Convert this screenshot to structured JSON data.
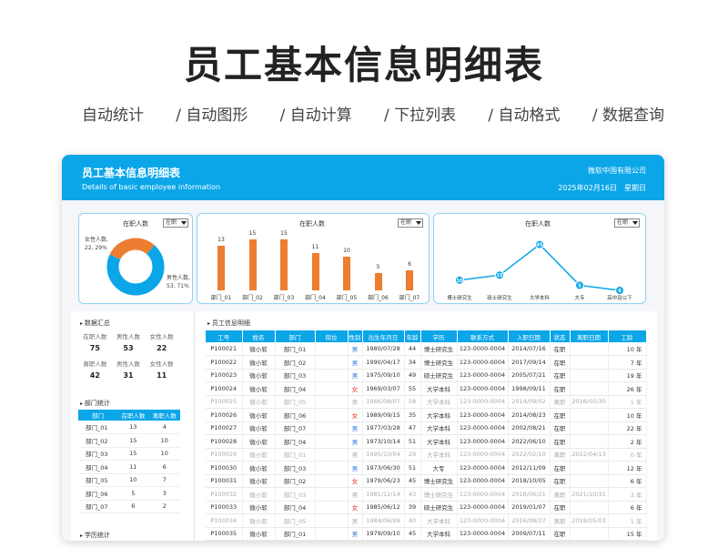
{
  "hero": {
    "title": "员工基本信息明细表",
    "features": [
      "自动统计",
      "/  自动图形",
      "/  自动计算",
      "/  下拉列表",
      "/  自动格式",
      "/  数据查询"
    ]
  },
  "header": {
    "title": "员工基本信息明细表",
    "subtitle": "Details of basic employee information",
    "company": "微软中国有限公司",
    "date": "2025年02月16日",
    "weekday": "星期日"
  },
  "colors": {
    "accent": "#0aa6e8",
    "bar": "#ed7d31",
    "card_border": "#8fd3f0"
  },
  "filter": {
    "selected": "在职"
  },
  "donut": {
    "title": "在职人数",
    "female_label": "女性人数,",
    "female_value": "22, 29%",
    "male_label": "男性人数,",
    "male_value": "53, 71%"
  },
  "bar_card": {
    "title": "在职人数"
  },
  "line_card": {
    "title": "在职人数"
  },
  "chart_data": [
    {
      "type": "pie",
      "title": "在职人数",
      "categories": [
        "女性人数",
        "男性人数"
      ],
      "values": [
        22,
        53
      ],
      "percent": [
        29,
        71
      ],
      "colors": [
        "#ed7d31",
        "#0aa6e8"
      ]
    },
    {
      "type": "bar",
      "title": "在职人数",
      "categories": [
        "部门_01",
        "部门_02",
        "部门_03",
        "部门_04",
        "部门_05",
        "部门_06",
        "部门_07"
      ],
      "values": [
        13,
        15,
        15,
        11,
        10,
        5,
        6
      ],
      "ylim": [
        0,
        16
      ]
    },
    {
      "type": "line",
      "title": "在职人数",
      "categories": [
        "博士研究生",
        "硕士研究生",
        "大学本科",
        "大专",
        "高中及以下"
      ],
      "values": [
        10,
        15,
        45,
        5,
        0
      ],
      "ylim": [
        0,
        50
      ]
    }
  ],
  "summary": {
    "title": "数据汇总",
    "labels_row1": [
      "在职人数",
      "男性人数",
      "女性人数"
    ],
    "values_row1": [
      "75",
      "53",
      "22"
    ],
    "labels_row2": [
      "离职人数",
      "男性人数",
      "女性人数"
    ],
    "values_row2": [
      "42",
      "31",
      "11"
    ]
  },
  "dept": {
    "title": "部门统计",
    "headers": [
      "部门",
      "在职人数",
      "离职人数"
    ],
    "rows": [
      [
        "部门_01",
        "13",
        "4"
      ],
      [
        "部门_02",
        "15",
        "10"
      ],
      [
        "部门_03",
        "15",
        "10"
      ],
      [
        "部门_04",
        "11",
        "6"
      ],
      [
        "部门_05",
        "10",
        "7"
      ],
      [
        "部门_06",
        "5",
        "3"
      ],
      [
        "部门_07",
        "6",
        "2"
      ]
    ]
  },
  "edu_title": "学历统计",
  "employee": {
    "title": "员工信息明细",
    "headers": [
      "工号",
      "姓名",
      "部门",
      "岗位",
      "性别",
      "出生年月日",
      "年龄",
      "学历",
      "联系方式",
      "入职日期",
      "状态",
      "离职日期",
      "工龄"
    ],
    "rows": [
      {
        "c": [
          "P100021",
          "微小软",
          "部门_01",
          "",
          "男",
          "1980/07/28",
          "44",
          "博士研究生",
          "123-0000-0004",
          "2014/07/16",
          "在职",
          "",
          "10 年"
        ],
        "left": false
      },
      {
        "c": [
          "P100022",
          "微小软",
          "部门_02",
          "",
          "男",
          "1990/04/17",
          "34",
          "博士研究生",
          "123-0000-0004",
          "2017/09/14",
          "在职",
          "",
          "7 年"
        ],
        "left": false
      },
      {
        "c": [
          "P100023",
          "微小软",
          "部门_03",
          "",
          "男",
          "1975/09/10",
          "49",
          "硕士研究生",
          "123-0000-0004",
          "2005/07/21",
          "在职",
          "",
          "19 年"
        ],
        "left": false
      },
      {
        "c": [
          "P100024",
          "微小软",
          "部门_04",
          "",
          "女",
          "1969/03/07",
          "55",
          "大学本科",
          "123-0000-0004",
          "1998/09/11",
          "在职",
          "",
          "26 年"
        ],
        "left": false
      },
      {
        "c": [
          "P100025",
          "微小软",
          "部门_05",
          "",
          "男",
          "1966/08/07",
          "58",
          "大学本科",
          "123-0000-0004",
          "2014/09/02",
          "离职",
          "2016/05/30",
          "1 年"
        ],
        "left": true
      },
      {
        "c": [
          "P100026",
          "微小软",
          "部门_06",
          "",
          "女",
          "1989/09/15",
          "35",
          "大学本科",
          "123-0000-0004",
          "2014/08/23",
          "在职",
          "",
          "10 年"
        ],
        "left": false
      },
      {
        "c": [
          "P100027",
          "微小软",
          "部门_07",
          "",
          "男",
          "1977/03/28",
          "47",
          "大学本科",
          "123-0000-0004",
          "2002/08/21",
          "在职",
          "",
          "22 年"
        ],
        "left": false
      },
      {
        "c": [
          "P100028",
          "微小软",
          "部门_04",
          "",
          "男",
          "1973/10/14",
          "51",
          "大学本科",
          "123-0000-0004",
          "2022/06/10",
          "在职",
          "",
          "2 年"
        ],
        "left": false
      },
      {
        "c": [
          "P100029",
          "微小软",
          "部门_01",
          "",
          "男",
          "1995/10/04",
          "29",
          "大学本科",
          "123-0000-0004",
          "2022/02/10",
          "离职",
          "2022/04/13",
          "0 年"
        ],
        "left": true
      },
      {
        "c": [
          "P100030",
          "微小软",
          "部门_03",
          "",
          "男",
          "1973/06/30",
          "51",
          "大专",
          "123-0000-0004",
          "2012/11/09",
          "在职",
          "",
          "12 年"
        ],
        "left": false
      },
      {
        "c": [
          "P100031",
          "微小软",
          "部门_02",
          "",
          "女",
          "1979/06/23",
          "45",
          "博士研究生",
          "123-0000-0004",
          "2018/10/05",
          "在职",
          "",
          "6 年"
        ],
        "left": false
      },
      {
        "c": [
          "P100032",
          "微小软",
          "部门_03",
          "",
          "男",
          "1981/12/14",
          "43",
          "博士研究生",
          "123-0000-0004",
          "2018/06/21",
          "离职",
          "2021/10/31",
          "3 年"
        ],
        "left": true
      },
      {
        "c": [
          "P100033",
          "微小软",
          "部门_04",
          "",
          "女",
          "1985/06/12",
          "39",
          "硕士研究生",
          "123-0000-0004",
          "2019/01/07",
          "在职",
          "",
          "6 年"
        ],
        "left": false
      },
      {
        "c": [
          "P100034",
          "微小软",
          "部门_05",
          "",
          "男",
          "1984/06/09",
          "40",
          "大学本科",
          "123-0000-0004",
          "2016/09/27",
          "离职",
          "2018/05/03",
          "1 年"
        ],
        "left": true
      },
      {
        "c": [
          "P100035",
          "微小软",
          "部门_01",
          "",
          "男",
          "1979/09/10",
          "45",
          "大学本科",
          "123-0000-0004",
          "2009/07/11",
          "在职",
          "",
          "15 年"
        ],
        "left": false
      }
    ]
  }
}
